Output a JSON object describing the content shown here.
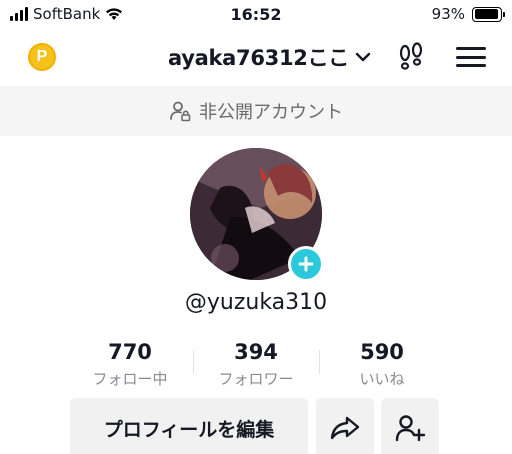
{
  "status_bar": {
    "carrier": "SoftBank",
    "time": "16:52",
    "battery_percent": "93%",
    "battery_level": 0.93
  },
  "header": {
    "coin_icon_label": "P",
    "username": "ayaka76312ここ",
    "icons": [
      "coin-icon",
      "chevron-down-icon",
      "footprint-icon",
      "menu-icon"
    ]
  },
  "private_banner": {
    "label": "非公開アカウント",
    "icon": "user-lock-icon"
  },
  "profile": {
    "handle": "@yuzuka310",
    "add_icon": "plus-icon"
  },
  "stats": [
    {
      "value": "770",
      "label": "フォロー中"
    },
    {
      "value": "394",
      "label": "フォロワー"
    },
    {
      "value": "590",
      "label": "いいね"
    }
  ],
  "actions": {
    "edit_profile": "プロフィールを編集",
    "share_icon": "share-icon",
    "add_friend_icon": "add-user-icon"
  },
  "colors": {
    "accent_cyan": "#2bc8dc",
    "coin_gold": "#f5c21b",
    "button_bg": "#f1f1f2",
    "banner_bg": "#f5f5f5",
    "secondary_text": "#8a8b91"
  }
}
